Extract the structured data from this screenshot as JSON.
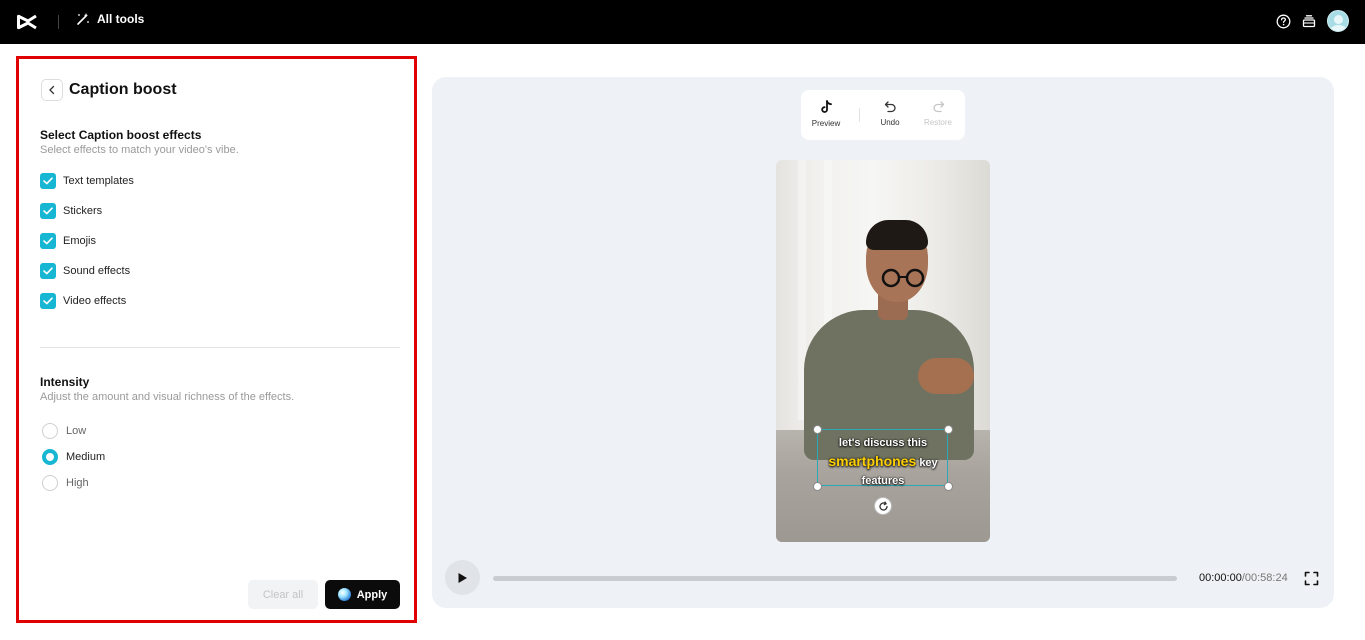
{
  "topbar": {
    "logo_icon": "capcut-logo-icon",
    "all_tools_label": "All tools",
    "icons": [
      "help-icon",
      "stack-icon",
      "avatar"
    ]
  },
  "panel": {
    "title": "Caption boost",
    "effects_title": "Select Caption boost effects",
    "effects_subtitle": "Select effects to match your video's vibe.",
    "effects": [
      {
        "label": "Text templates",
        "checked": true
      },
      {
        "label": "Stickers",
        "checked": true
      },
      {
        "label": "Emojis",
        "checked": true
      },
      {
        "label": "Sound effects",
        "checked": true
      },
      {
        "label": "Video effects",
        "checked": true
      }
    ],
    "intensity_title": "Intensity",
    "intensity_subtitle": "Adjust the amount and visual richness of the effects.",
    "intensity_options": [
      {
        "label": "Low",
        "selected": false
      },
      {
        "label": "Medium",
        "selected": true
      },
      {
        "label": "High",
        "selected": false
      }
    ],
    "clear_label": "Clear all",
    "apply_label": "Apply"
  },
  "preview": {
    "toolbar": {
      "preview_label": "Preview",
      "undo_label": "Undo",
      "restore_label": "Restore"
    },
    "caption": {
      "line1": "let's discuss this",
      "highlight": "smartphones",
      "line2_rest": "key",
      "line3": "features"
    },
    "time_current": "00:00:00",
    "time_total": "/00:58:24",
    "progress": 0
  },
  "colors": {
    "accent": "#17b6d2",
    "highlight_border": "#e00000",
    "caption_highlight": "#ffd000"
  }
}
